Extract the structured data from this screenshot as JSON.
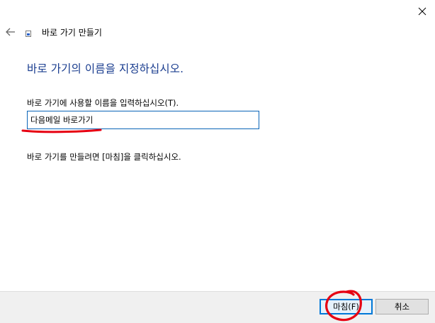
{
  "window": {
    "close_icon": "close-icon",
    "back_icon": "back-arrow-icon",
    "wizard_icon": "shortcut-icon"
  },
  "wizard": {
    "title": "바로 가기 만들기",
    "heading": "바로 가기의 이름을 지정하십시오.",
    "name_label": "바로 가기에 사용할 이름을 입력하십시오(T).",
    "name_value": "다음메일 바로가기",
    "instruction": "바로 가기를 만들려면 [마침]을 클릭하십시오."
  },
  "buttons": {
    "finish": "마침(F)",
    "cancel": "취소"
  },
  "colors": {
    "heading": "#1a3d8f",
    "annotation": "#e60012",
    "focus_border": "#0078d7"
  }
}
